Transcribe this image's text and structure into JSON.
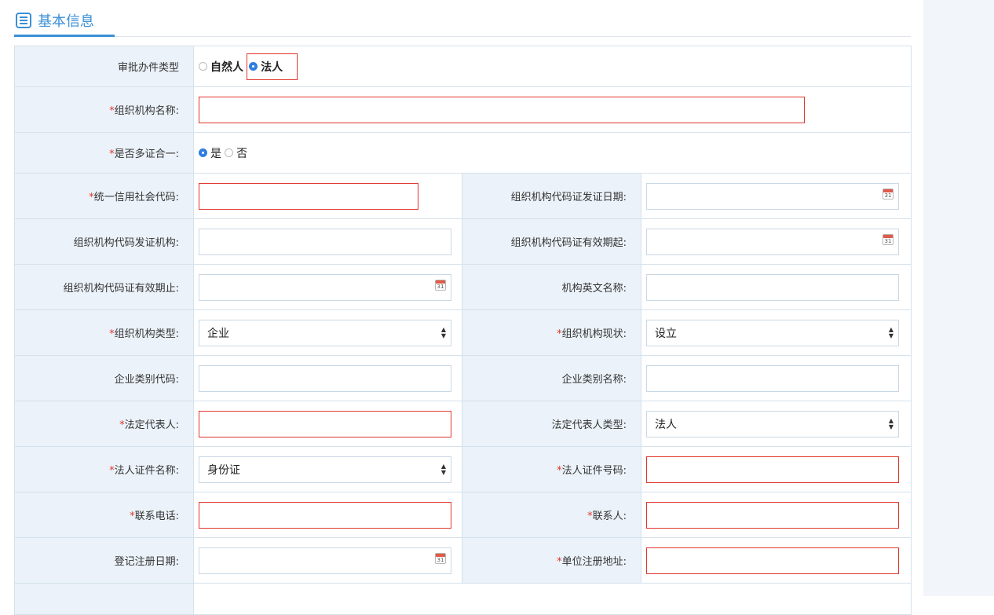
{
  "section": {
    "title": "基本信息",
    "icon": "list-icon"
  },
  "colors": {
    "accent": "#3b8fd6",
    "required": "#e0362c",
    "label_bg": "#ebf2f9"
  },
  "approval_type": {
    "label": "审批办件类型",
    "options": [
      "自然人",
      "法人"
    ],
    "selected": "法人"
  },
  "org_name": {
    "label": "组织机构名称:",
    "value": ""
  },
  "multi_cert": {
    "label": "是否多证合一:",
    "options": [
      "是",
      "否"
    ],
    "selected": "是"
  },
  "rows": {
    "credit_code": {
      "label": "统一信用社会代码:"
    },
    "org_code_issue_date": {
      "label": "组织机构代码证发证日期:",
      "calendar": "31"
    },
    "org_code_issuer": {
      "label": "组织机构代码发证机构:"
    },
    "org_code_valid_from": {
      "label": "组织机构代码证有效期起:",
      "calendar": "31"
    },
    "org_code_valid_to": {
      "label": "组织机构代码证有效期止:",
      "calendar": "31"
    },
    "org_english_name": {
      "label": "机构英文名称:"
    },
    "org_type": {
      "label": "组织机构类型:",
      "value": "企业"
    },
    "org_status": {
      "label": "组织机构现状:",
      "value": "设立"
    },
    "ent_category_code": {
      "label": "企业类别代码:"
    },
    "ent_category_name": {
      "label": "企业类别名称:"
    },
    "legal_rep": {
      "label": "法定代表人:"
    },
    "legal_rep_type": {
      "label": "法定代表人类型:",
      "value": "法人"
    },
    "legal_id_name": {
      "label": "法人证件名称:",
      "value": "身份证"
    },
    "legal_id_number": {
      "label": "法人证件号码:"
    },
    "phone": {
      "label": "联系电话:"
    },
    "contact": {
      "label": "联系人:"
    },
    "reg_date": {
      "label": "登记注册日期:",
      "calendar": "31"
    },
    "reg_address": {
      "label": "单位注册地址:"
    }
  }
}
